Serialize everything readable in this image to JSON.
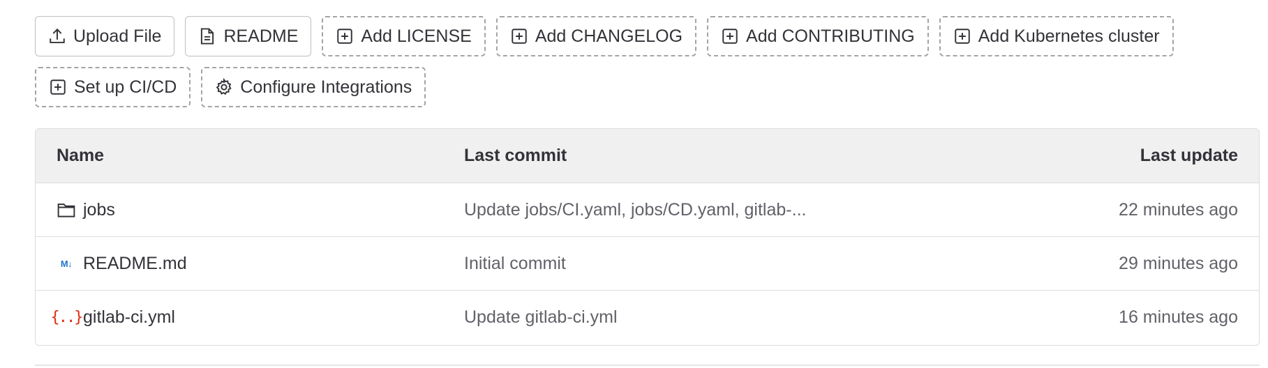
{
  "actions": {
    "upload_file": "Upload File",
    "readme": "README",
    "add_license": "Add LICENSE",
    "add_changelog": "Add CHANGELOG",
    "add_contributing": "Add CONTRIBUTING",
    "add_kubernetes": "Add Kubernetes cluster",
    "setup_cicd": "Set up CI/CD",
    "configure_integrations": "Configure Integrations"
  },
  "table": {
    "headers": {
      "name": "Name",
      "last_commit": "Last commit",
      "last_update": "Last update"
    },
    "rows": [
      {
        "icon": "folder-icon",
        "name": "jobs",
        "commit": "Update jobs/CI.yaml, jobs/CD.yaml, gitlab-...",
        "updated": "22 minutes ago"
      },
      {
        "icon": "markdown-icon",
        "icon_text": "M↓",
        "name": "README.md",
        "commit": "Initial commit",
        "updated": "29 minutes ago"
      },
      {
        "icon": "yaml-icon",
        "icon_text": "{..}",
        "name": "gitlab-ci.yml",
        "commit": "Update gitlab-ci.yml",
        "updated": "16 minutes ago"
      }
    ]
  },
  "colors": {
    "text": "#333238",
    "muted": "#626168",
    "header_bg": "#f0f0f0",
    "border": "#dcdcde",
    "markdown_blue": "#1f75cb",
    "yaml_red": "#dd2b0e"
  }
}
